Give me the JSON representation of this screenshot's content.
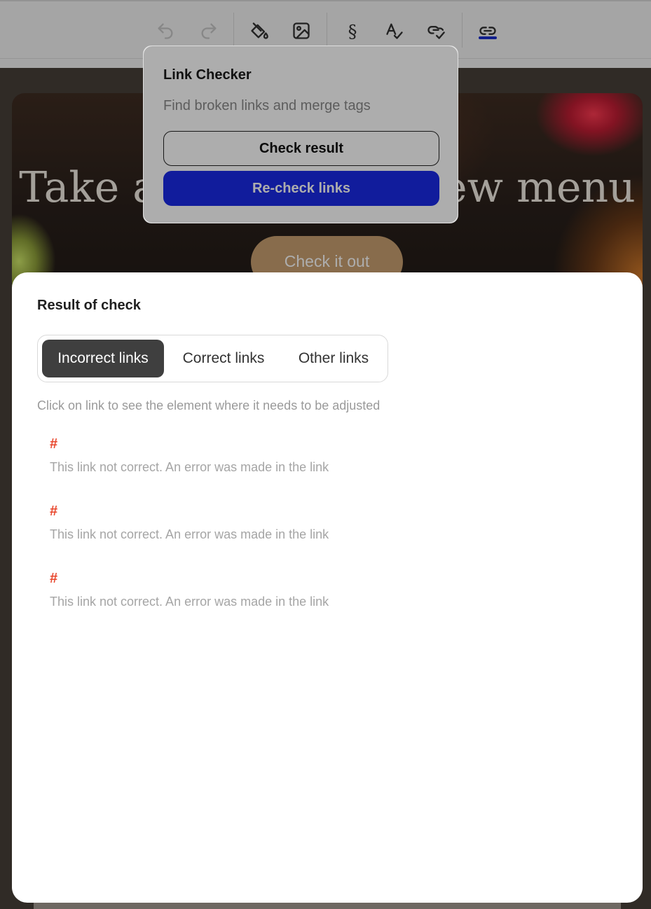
{
  "toolbar": {
    "icons": [
      "undo-icon",
      "redo-icon",
      "paint-bucket-icon",
      "image-icon",
      "section-sign-icon",
      "spellcheck-icon",
      "link-check-icon",
      "link-icon"
    ],
    "accent": "#1a2ecf"
  },
  "hero": {
    "title": "Take a look at our new menu",
    "button_label": "Check it out",
    "button_color": "#c9a070"
  },
  "popover": {
    "title": "Link Checker",
    "subtitle": "Find broken links and merge tags",
    "check_result_label": "Check result",
    "recheck_label": "Re-check links",
    "primary_color": "#1a2ae6"
  },
  "result": {
    "title": "Result of check",
    "tabs": [
      {
        "label": "Incorrect links",
        "active": true
      },
      {
        "label": "Correct links",
        "active": false
      },
      {
        "label": "Other links",
        "active": false
      }
    ],
    "hint": "Click on link to see the element where it needs to be adjusted",
    "items": [
      {
        "link": "#",
        "message": "This link not correct. An error was made in the link"
      },
      {
        "link": "#",
        "message": "This link not correct. An error was made in the link"
      },
      {
        "link": "#",
        "message": "This link not correct. An error was made in the link"
      }
    ],
    "error_color": "#e8452b"
  }
}
